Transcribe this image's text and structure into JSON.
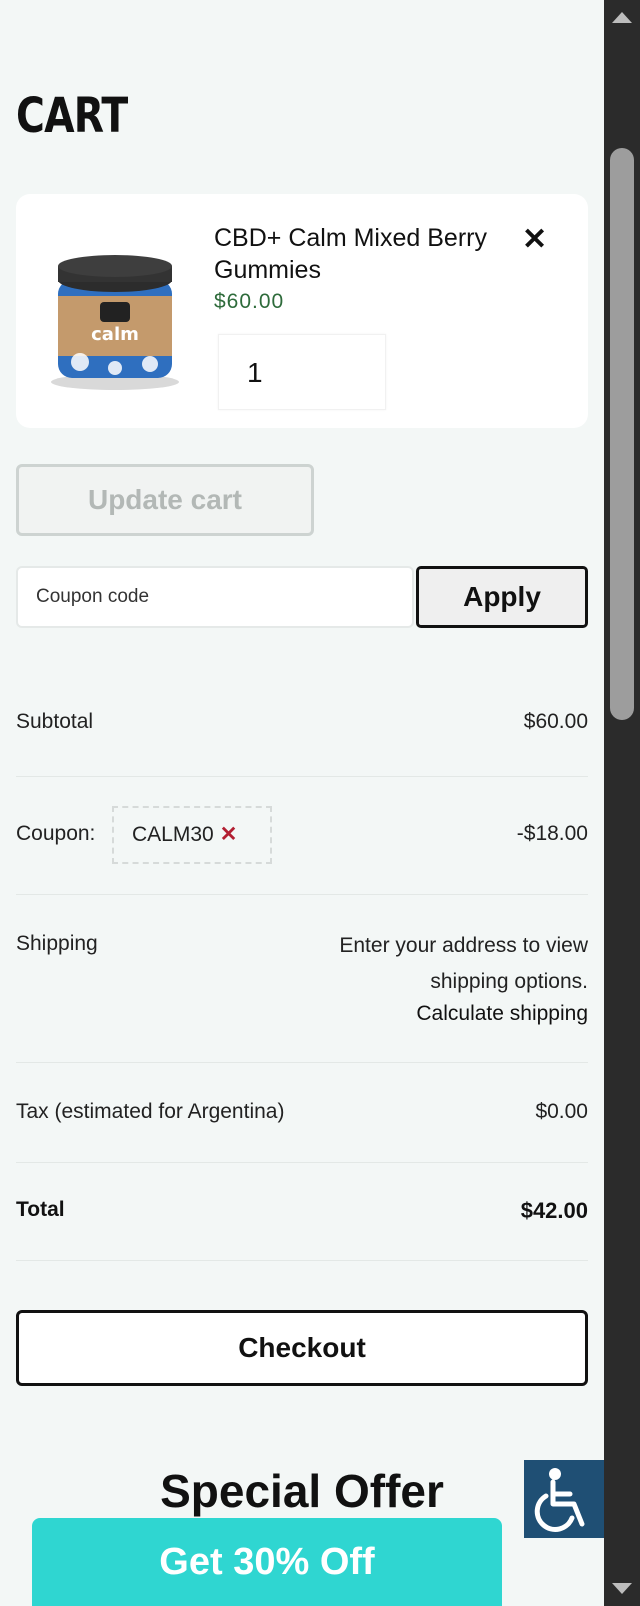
{
  "page": {
    "title": "CART"
  },
  "cart": {
    "item": {
      "name": "CBD+ Calm Mixed Berry Gummies",
      "price": "$60.00",
      "quantity": "1",
      "image_label": "calm"
    },
    "update_button": "Update cart",
    "coupon_placeholder": "Coupon code",
    "apply_button": "Apply"
  },
  "totals": {
    "subtotal_label": "Subtotal",
    "subtotal_value": "$60.00",
    "coupon_label": "Coupon:",
    "coupon_code": "CALM30",
    "coupon_value": "-$18.00",
    "shipping_label": "Shipping",
    "shipping_text": "Enter your address to view shipping options.",
    "calculate_shipping": "Calculate shipping",
    "tax_label": "Tax (estimated for Argentina)",
    "tax_value": "$0.00",
    "total_label": "Total",
    "total_value": "$42.00"
  },
  "checkout_button": "Checkout",
  "promo": {
    "heading": "Special Offer",
    "button": "Get 30% Off"
  },
  "icons": {
    "remove": "close-icon",
    "coupon_remove": "close-icon",
    "accessibility": "wheelchair-icon"
  },
  "colors": {
    "price_green": "#2e6b3b",
    "promo_cyan": "#2fd6d1",
    "accessibility_blue": "#1f4f74",
    "coupon_remove_red": "#b21f32"
  }
}
